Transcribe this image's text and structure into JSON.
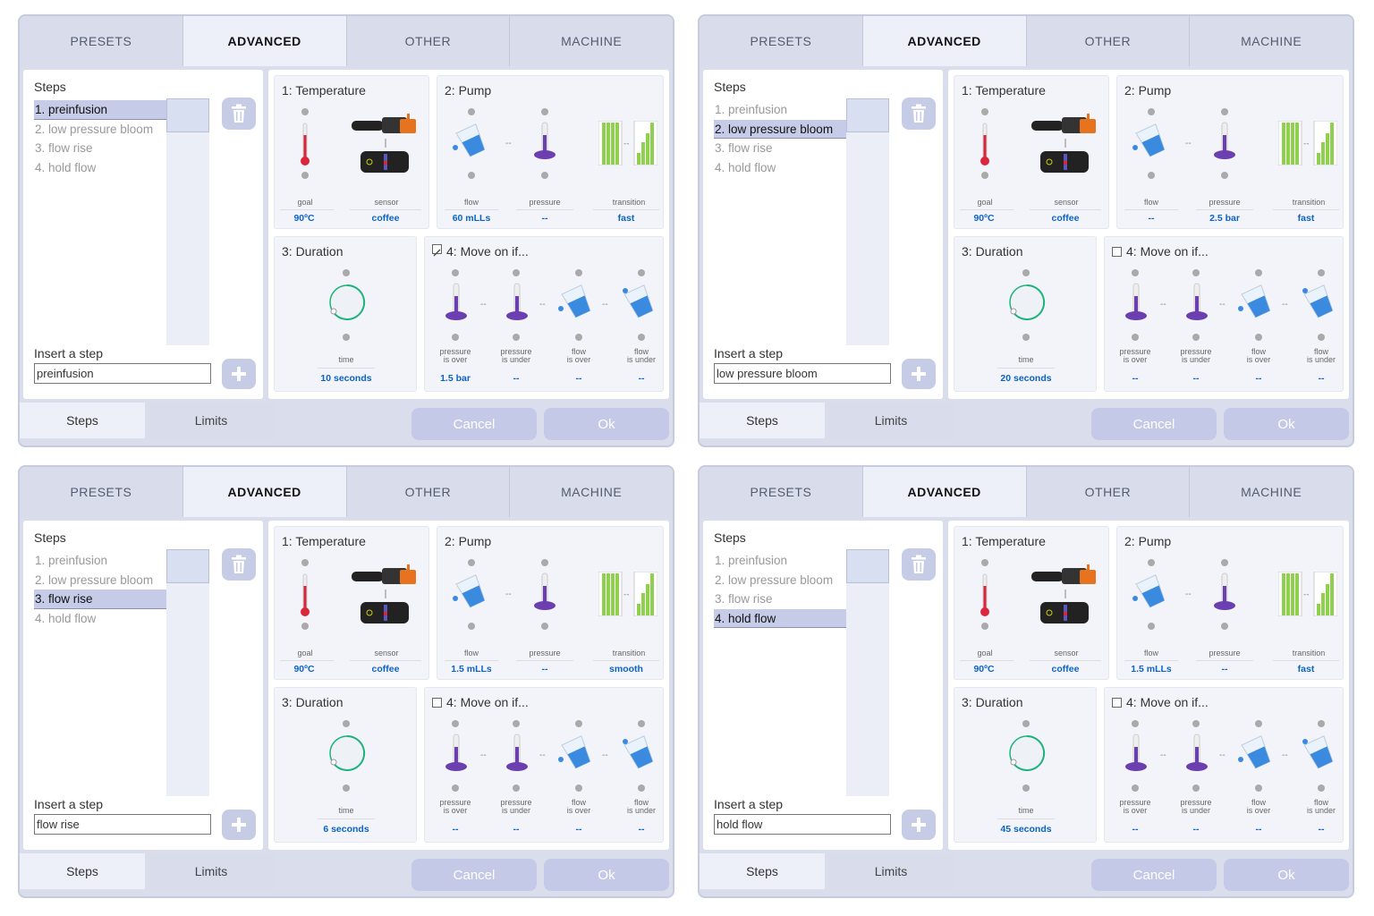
{
  "tabs": [
    "PRESETS",
    "ADVANCED",
    "OTHER",
    "MACHINE"
  ],
  "steps_label": "Steps",
  "steps": [
    "1. preinfusion",
    "2. low pressure bloom",
    "3. flow rise",
    "4. hold flow"
  ],
  "insert_label": "Insert a step",
  "temperature_title": "1: Temperature",
  "pump_title": "2: Pump",
  "duration_title": "3: Duration",
  "moveon_title": "4: Move on if...",
  "labels": {
    "goal": "goal",
    "sensor": "sensor",
    "flow": "flow",
    "pressure": "pressure",
    "transition": "transition",
    "time": "time",
    "pressure_is": "pressure",
    "is_over": "is over",
    "is_under": "is under",
    "flow_is": "flow"
  },
  "footer": {
    "steps": "Steps",
    "limits": "Limits",
    "cancel": "Cancel",
    "ok": "Ok"
  },
  "panels": [
    {
      "selected": 0,
      "insert_value": "preinfusion",
      "goal": "90ºC",
      "sensor": "coffee",
      "flow": "60 mLLs",
      "pressure": "--",
      "transition": "fast",
      "time": "10 seconds",
      "moveon_checked": true,
      "p_over": "1.5 bar",
      "p_under": "--",
      "f_over": "--",
      "f_under": "--"
    },
    {
      "selected": 1,
      "insert_value": "low pressure bloom",
      "goal": "90ºC",
      "sensor": "coffee",
      "flow": "--",
      "pressure": "2.5 bar",
      "transition": "fast",
      "time": "20 seconds",
      "moveon_checked": false,
      "p_over": "--",
      "p_under": "--",
      "f_over": "--",
      "f_under": "--"
    },
    {
      "selected": 2,
      "insert_value": "flow rise",
      "goal": "90ºC",
      "sensor": "coffee",
      "flow": "1.5 mLLs",
      "pressure": "--",
      "transition": "smooth",
      "time": "6 seconds",
      "moveon_checked": false,
      "p_over": "--",
      "p_under": "--",
      "f_over": "--",
      "f_under": "--"
    },
    {
      "selected": 3,
      "insert_value": "hold flow",
      "goal": "90ºC",
      "sensor": "coffee",
      "flow": "1.5 mLLs",
      "pressure": "--",
      "transition": "fast",
      "time": "45 seconds",
      "moveon_checked": false,
      "p_over": "--",
      "p_under": "--",
      "f_over": "--",
      "f_under": "--"
    }
  ],
  "colors": {
    "accent": "#0b63c5",
    "button": "#c4c9e8",
    "thermo": "#d9263a",
    "pump_bar": "#8fd14f",
    "purple": "#6b3fb0",
    "water": "#3a8be0",
    "timer": "#1fb37a"
  }
}
